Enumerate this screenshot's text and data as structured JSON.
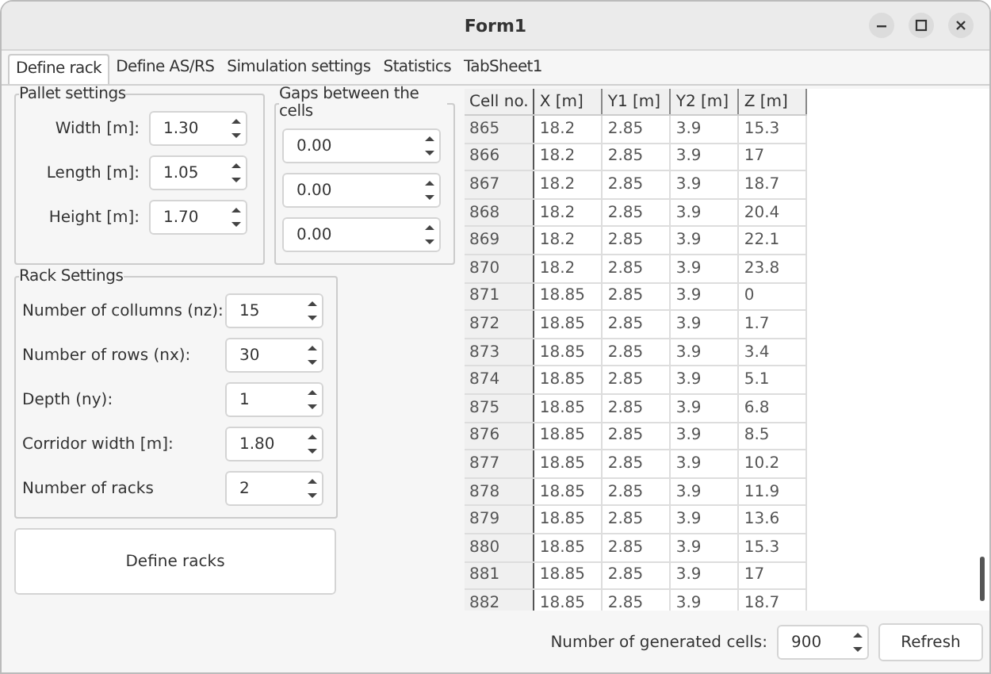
{
  "window": {
    "title": "Form1"
  },
  "tabs": [
    {
      "label": "Define rack",
      "selected": true
    },
    {
      "label": "Define AS/RS",
      "selected": false
    },
    {
      "label": "Simulation settings",
      "selected": false
    },
    {
      "label": "Statistics",
      "selected": false
    },
    {
      "label": "TabSheet1",
      "selected": false
    }
  ],
  "pallet_settings": {
    "title": "Pallet settings",
    "fields": [
      {
        "label": "Width [m]:",
        "value": "1.30"
      },
      {
        "label": "Length [m]:",
        "value": "1.05"
      },
      {
        "label": "Height [m]:",
        "value": "1.70"
      }
    ]
  },
  "gaps": {
    "title": "Gaps between the cells",
    "fields": [
      {
        "value": "0.00"
      },
      {
        "value": "0.00"
      },
      {
        "value": "0.00"
      }
    ]
  },
  "rack_settings": {
    "title": "Rack Settings",
    "fields": [
      {
        "label": "Number of collumns (nz):",
        "value": "15"
      },
      {
        "label": "Number of rows (nx):",
        "value": "30"
      },
      {
        "label": "Depth (ny):",
        "value": "1"
      },
      {
        "label": "Corridor width [m]:",
        "value": "1.80"
      },
      {
        "label": "Number of racks",
        "value": "2"
      }
    ]
  },
  "define_button": "Define racks",
  "table": {
    "columns": [
      "Cell no.",
      "X [m]",
      "Y1 [m]",
      "Y2 [m]",
      "Z [m]"
    ],
    "rows": [
      [
        "865",
        "18.2",
        "2.85",
        "3.9",
        "15.3"
      ],
      [
        "866",
        "18.2",
        "2.85",
        "3.9",
        "17"
      ],
      [
        "867",
        "18.2",
        "2.85",
        "3.9",
        "18.7"
      ],
      [
        "868",
        "18.2",
        "2.85",
        "3.9",
        "20.4"
      ],
      [
        "869",
        "18.2",
        "2.85",
        "3.9",
        "22.1"
      ],
      [
        "870",
        "18.2",
        "2.85",
        "3.9",
        "23.8"
      ],
      [
        "871",
        "18.85",
        "2.85",
        "3.9",
        "0"
      ],
      [
        "872",
        "18.85",
        "2.85",
        "3.9",
        "1.7"
      ],
      [
        "873",
        "18.85",
        "2.85",
        "3.9",
        "3.4"
      ],
      [
        "874",
        "18.85",
        "2.85",
        "3.9",
        "5.1"
      ],
      [
        "875",
        "18.85",
        "2.85",
        "3.9",
        "6.8"
      ],
      [
        "876",
        "18.85",
        "2.85",
        "3.9",
        "8.5"
      ],
      [
        "877",
        "18.85",
        "2.85",
        "3.9",
        "10.2"
      ],
      [
        "878",
        "18.85",
        "2.85",
        "3.9",
        "11.9"
      ],
      [
        "879",
        "18.85",
        "2.85",
        "3.9",
        "13.6"
      ],
      [
        "880",
        "18.85",
        "2.85",
        "3.9",
        "15.3"
      ],
      [
        "881",
        "18.85",
        "2.85",
        "3.9",
        "17"
      ],
      [
        "882",
        "18.85",
        "2.85",
        "3.9",
        "18.7"
      ]
    ]
  },
  "generated": {
    "label": "Number of generated cells:",
    "value": "900"
  },
  "refresh_button": "Refresh"
}
